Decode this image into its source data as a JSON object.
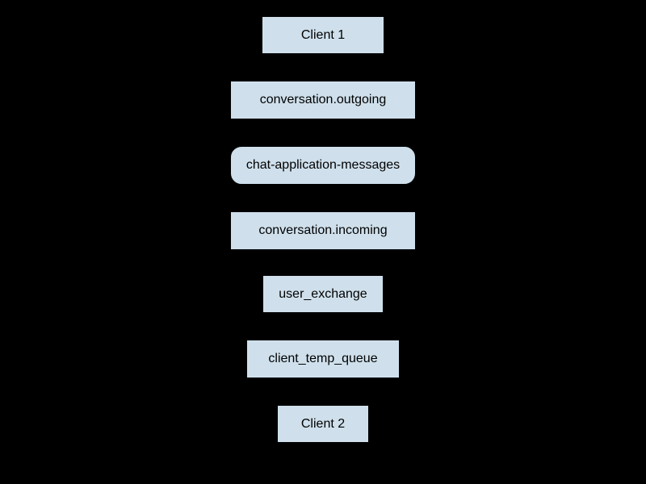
{
  "nodes": {
    "client1": {
      "label": "Client 1"
    },
    "outgoing": {
      "label": "conversation.outgoing"
    },
    "messages": {
      "label": "chat-application-messages"
    },
    "incoming": {
      "label": "conversation.incoming"
    },
    "exchange": {
      "label": "user_exchange"
    },
    "tempqueue": {
      "label": "client_temp_queue"
    },
    "client2": {
      "label": "Client 2"
    }
  }
}
